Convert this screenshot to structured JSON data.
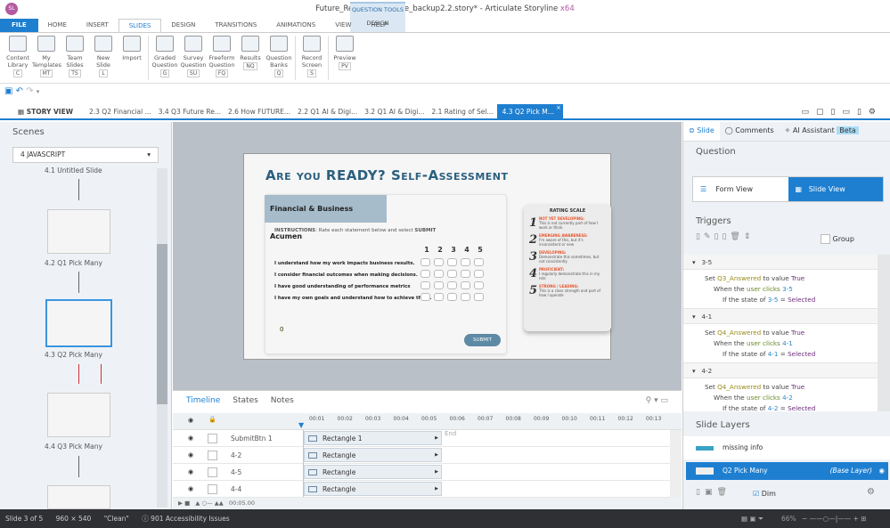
{
  "window": {
    "title": "Future_Ready_Workforce_backup2.2.story* - Articulate Storyline",
    "arch": "x64",
    "logo": "SL",
    "question_tools": "QUESTION TOOLS"
  },
  "ribbon_tabs": [
    "FILE",
    "HOME",
    "INSERT",
    "SLIDES",
    "DESIGN",
    "TRANSITIONS",
    "ANIMATIONS",
    "VIEW",
    "HELP"
  ],
  "context_tab": "DESIGN",
  "ribbon_buttons": [
    {
      "label": "Content Library",
      "key": "C"
    },
    {
      "label": "My Templates",
      "key": "MT"
    },
    {
      "label": "Team Slides",
      "key": "TS"
    },
    {
      "label": "New Slide",
      "key": "L"
    },
    {
      "label": "Import",
      "key": ""
    },
    {
      "label": "Graded Question",
      "key": "G"
    },
    {
      "label": "Survey Question",
      "key": "SU"
    },
    {
      "label": "Freeform Question",
      "key": "FQ"
    },
    {
      "label": "Results",
      "key": "NQ"
    },
    {
      "label": "Question Banks",
      "key": "Q"
    },
    {
      "label": "Record Screen",
      "key": "S"
    },
    {
      "label": "Preview",
      "key": "PV"
    }
  ],
  "slide_tabs": [
    "STORY VIEW",
    "2.3 Q2 Financial ...",
    "3.4 Q3 Future Re...",
    "2.6 How FUTURE...",
    "2.2 Q1 AI & Digi...",
    "3.2 Q1 AI & Digi...",
    "2.1 Rating of Sel...",
    "4.3 Q2 Pick M..."
  ],
  "scenes": {
    "title": "Scenes",
    "selected_scene": "4 JAVASCRIPT",
    "slides": [
      "4.1 Untitled Slide",
      "4.2 Q1 Pick Many",
      "4.3 Q2 Pick Many",
      "4.4 Q3 Pick Many"
    ]
  },
  "slide": {
    "title": "Are you READY?  Self-Assessment",
    "section": "Financial & Business Acumen",
    "instructions_label": "INSTRUCTIONS",
    "instructions": ": Rate each statement below and select ",
    "instructions_submit": "SUBMIT",
    "scale_headers": [
      "1",
      "2",
      "3",
      "4",
      "5"
    ],
    "statements": [
      "I understand how my work impacts business results.",
      "I consider financial outcomes when making decisions.",
      "I have good understanding of performance metrics",
      "I have my own goals and understand how to achieve them."
    ],
    "counter": "0",
    "submit": "SUBMIT",
    "rating_scale": {
      "title": "RATING SCALE",
      "items": [
        {
          "n": "1",
          "label": "NOT YET DEVELOPING:",
          "desc": "This is not currently part of how I work or think"
        },
        {
          "n": "2",
          "label": "EMERGING AWARENESS:",
          "desc": "I'm aware of this, but it's inconsistent or new"
        },
        {
          "n": "3",
          "label": "DEVELOPING:",
          "desc": "Demonstrate this sometimes, but not consistently"
        },
        {
          "n": "4",
          "label": "PROFICIENT:",
          "desc": "I regularly demonstrate this in my role"
        },
        {
          "n": "5",
          "label": "STRONG / LEADING:",
          "desc": "This is a clear strength and part of how I operate"
        }
      ]
    }
  },
  "timeline": {
    "tabs": [
      "Timeline",
      "States",
      "Notes"
    ],
    "ticks": [
      "00:01",
      "00:02",
      "00:03",
      "00:04",
      "00:05",
      "00:06",
      "00:07",
      "00:08",
      "00:09",
      "00:10",
      "00:11",
      "00:12",
      "00:13"
    ],
    "rows": [
      {
        "name": "SubmitBtn 1",
        "bar": "Rectangle 1"
      },
      {
        "name": "4-2",
        "bar": "Rectangle"
      },
      {
        "name": "4-5",
        "bar": "Rectangle"
      },
      {
        "name": "4-4",
        "bar": "Rectangle"
      }
    ],
    "end": "End",
    "duration": "00:05.00"
  },
  "right": {
    "tabs": [
      "Slide",
      "Comments",
      "AI Assistant"
    ],
    "beta": "Beta",
    "question_title": "Question",
    "form_view": "Form View",
    "slide_view": "Slide View",
    "triggers_title": "Triggers",
    "group": "Group",
    "triggers": [
      {
        "head": "3-5",
        "var": "Q3_Answered",
        "obj": "3-5"
      },
      {
        "head": "4-1",
        "var": "Q4_Answered",
        "obj": "4-1"
      },
      {
        "head": "4-2",
        "var": "Q4_Answered",
        "obj": "4-2"
      }
    ],
    "t_set": "Set",
    "t_to": "to value",
    "t_true": "True",
    "t_when": "When the",
    "t_user": "user clicks",
    "t_if": "If the state of",
    "t_eq": "=",
    "t_sel": "Selected",
    "layers_title": "Slide Layers",
    "layers": [
      {
        "name": "missing info"
      },
      {
        "name": "Q2 Pick Many",
        "tag": "(Base Layer)"
      }
    ],
    "dim": "Dim"
  },
  "status": {
    "slide": "Slide 3 of 5",
    "size": "960 × 540",
    "theme": "\"Clean\"",
    "a11y": "901 Accessibility Issues",
    "zoom": "66%"
  },
  "colors": {
    "accent": "#1e7fd1",
    "title": "#2b5f7f",
    "rating": "#e8542b"
  }
}
